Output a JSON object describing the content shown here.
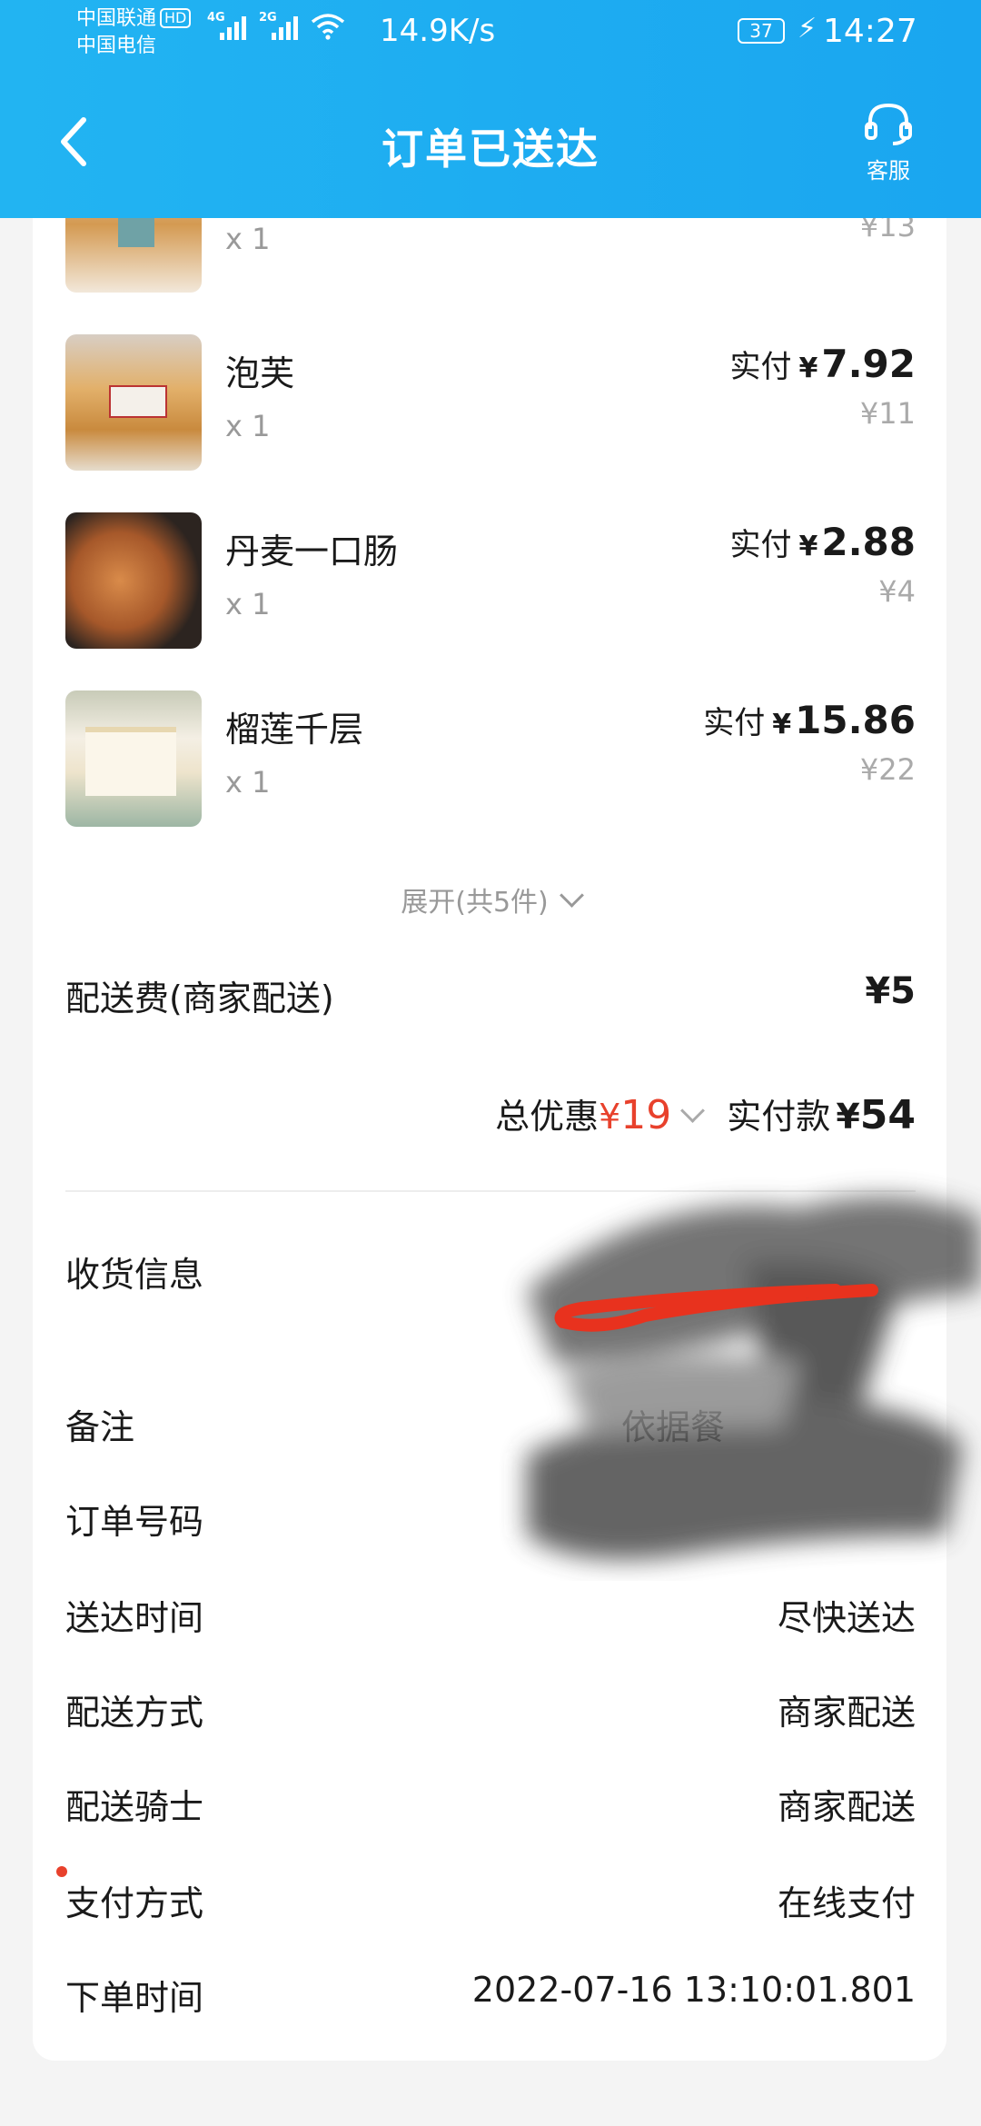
{
  "status_bar": {
    "carrier1": "中国联通",
    "carrier1_badge": "HD",
    "carrier2": "中国电信",
    "signal1_tag": "4G",
    "signal2_tag": "2G",
    "speed": "14.9K/s",
    "battery": "37",
    "time": "14:27"
  },
  "header": {
    "title": "订单已送达",
    "service_label": "客服",
    "colors": {
      "background": "#1aa6f0"
    }
  },
  "items": [
    {
      "name": "",
      "qty": "x 1",
      "paid_label": "",
      "paid_currency": "",
      "paid_amount": "",
      "original": "¥13"
    },
    {
      "name": "泡芙",
      "qty": "x 1",
      "paid_label": "实付",
      "paid_currency": "¥",
      "paid_amount": "7.92",
      "original": "¥11"
    },
    {
      "name": "丹麦一口肠",
      "qty": "x 1",
      "paid_label": "实付",
      "paid_currency": "¥",
      "paid_amount": "2.88",
      "original": "¥4"
    },
    {
      "name": "榴莲千层",
      "qty": "x 1",
      "paid_label": "实付",
      "paid_currency": "¥",
      "paid_amount": "15.86",
      "original": "¥22"
    }
  ],
  "expand_label": "展开(共5件)",
  "delivery_fee": {
    "label": "配送费(商家配送)",
    "value": "¥5"
  },
  "summary": {
    "discount_label": "总优惠",
    "discount_currency": "¥",
    "discount_value": "19",
    "paid_label": "实付款",
    "paid_currency": "¥",
    "paid_value": "54",
    "colors": {
      "discount": "#e8412c"
    }
  },
  "info": [
    {
      "key": "收货信息",
      "value": ""
    },
    {
      "key": "备注",
      "value": "依据餐"
    },
    {
      "key": "订单号码",
      "value": ""
    },
    {
      "key": "送达时间",
      "value": "尽快送达"
    },
    {
      "key": "配送方式",
      "value": "商家配送"
    },
    {
      "key": "配送骑士",
      "value": "商家配送"
    },
    {
      "key": "支付方式",
      "value": "在线支付"
    },
    {
      "key": "下单时间",
      "value": "2022-07-16 13:10:01.801"
    }
  ]
}
